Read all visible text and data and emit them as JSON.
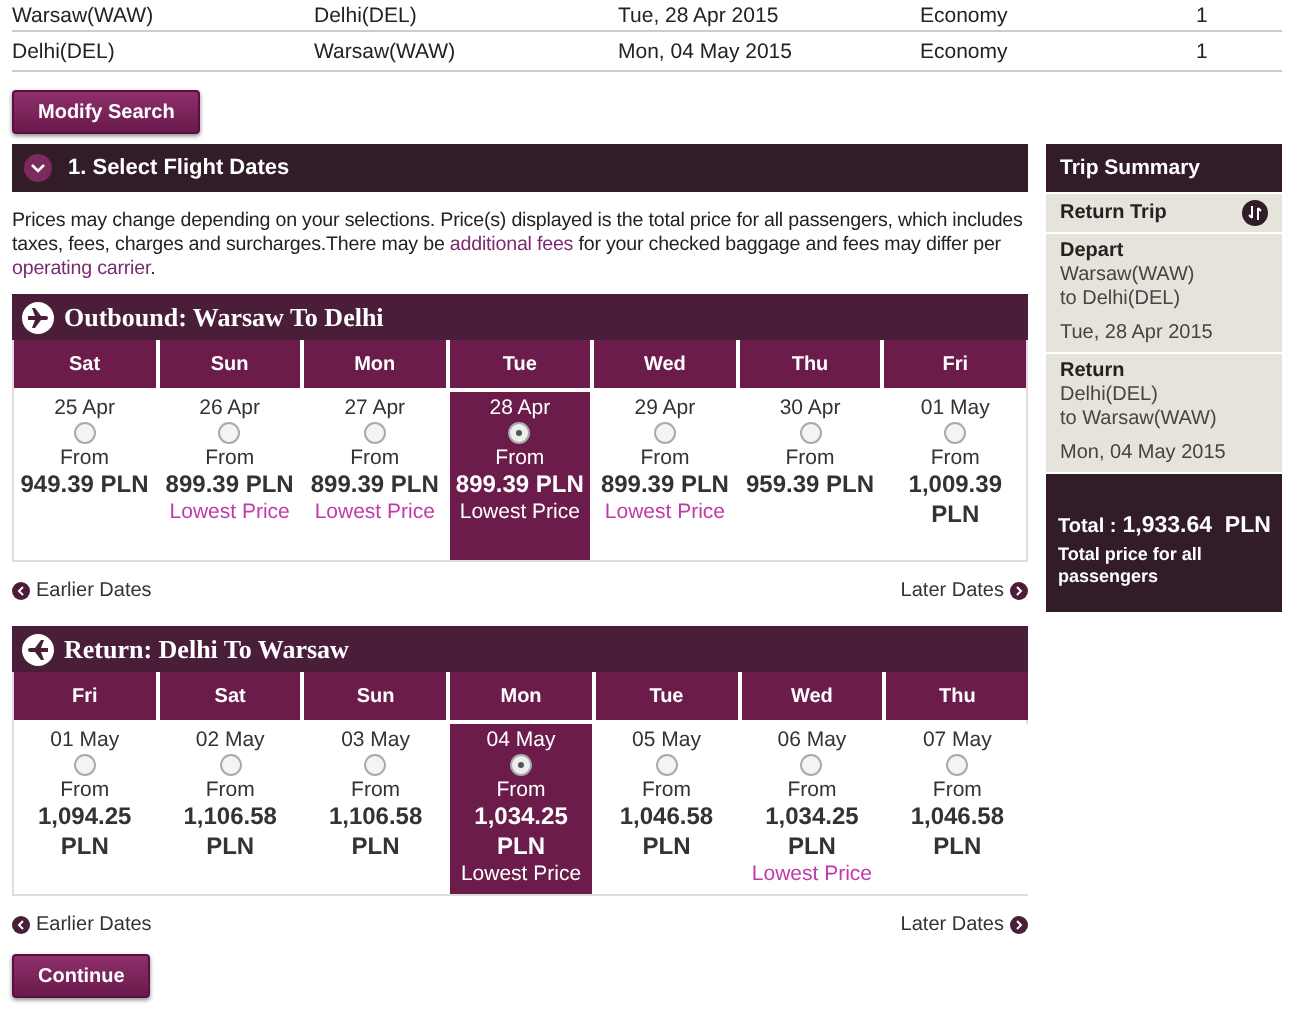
{
  "search_table": {
    "rows": [
      {
        "from": "Warsaw(WAW)",
        "to": "Delhi(DEL)",
        "date": "Tue, 28 Apr 2015",
        "cabin": "Economy",
        "passengers": "1"
      },
      {
        "from": "Delhi(DEL)",
        "to": "Warsaw(WAW)",
        "date": "Mon, 04 May 2015",
        "cabin": "Economy",
        "passengers": "1"
      }
    ]
  },
  "modify_button": "Modify Search",
  "section": {
    "title": "1. Select Flight Dates",
    "expanded": true
  },
  "notice": {
    "text_1": "Prices may change depending on your selections. Price(s) displayed is the total price for all passengers, which includes taxes, fees, charges and surcharges.There may be ",
    "link_1": "additional fees",
    "text_2": " for your checked baggage and fees may differ per ",
    "link_2": "operating carrier",
    "text_3": "."
  },
  "legs": [
    {
      "kind": "outbound",
      "title": "Outbound: Warsaw To Delhi",
      "earlier": "Earlier Dates",
      "later": "Later Dates",
      "days": [
        {
          "weekday": "Sat",
          "date": "25 Apr",
          "from": "From",
          "price": "949.39 PLN",
          "selected": false
        },
        {
          "weekday": "Sun",
          "date": "26 Apr",
          "from": "From",
          "price": "899.39 PLN",
          "note": "Lowest Price",
          "selected": false
        },
        {
          "weekday": "Mon",
          "date": "27 Apr",
          "from": "From",
          "price": "899.39 PLN",
          "note": "Lowest Price",
          "selected": false
        },
        {
          "weekday": "Tue",
          "date": "28 Apr",
          "from": "From",
          "price": "899.39 PLN",
          "note": "Lowest Price",
          "selected": true
        },
        {
          "weekday": "Wed",
          "date": "29 Apr",
          "from": "From",
          "price": "899.39 PLN",
          "note": "Lowest Price",
          "selected": false
        },
        {
          "weekday": "Thu",
          "date": "30 Apr",
          "from": "From",
          "price": "959.39 PLN",
          "selected": false
        },
        {
          "weekday": "Fri",
          "date": "01 May",
          "from": "From",
          "price": "1,009.39 PLN",
          "selected": false
        }
      ]
    },
    {
      "kind": "return",
      "title": "Return: Delhi To Warsaw",
      "earlier": "Earlier Dates",
      "later": "Later Dates",
      "days": [
        {
          "weekday": "Fri",
          "date": "01 May",
          "from": "From",
          "price": "1,094.25 PLN",
          "selected": false
        },
        {
          "weekday": "Sat",
          "date": "02 May",
          "from": "From",
          "price": "1,106.58 PLN",
          "selected": false
        },
        {
          "weekday": "Sun",
          "date": "03 May",
          "from": "From",
          "price": "1,106.58 PLN",
          "selected": false
        },
        {
          "weekday": "Mon",
          "date": "04 May",
          "from": "From",
          "price": "1,034.25 PLN",
          "note": "Lowest Price",
          "selected": true
        },
        {
          "weekday": "Tue",
          "date": "05 May",
          "from": "From",
          "price": "1,046.58 PLN",
          "selected": false
        },
        {
          "weekday": "Wed",
          "date": "06 May",
          "from": "From",
          "price": "1,034.25 PLN",
          "note": "Lowest Price",
          "selected": false
        },
        {
          "weekday": "Thu",
          "date": "07 May",
          "from": "From",
          "price": "1,046.58 PLN",
          "selected": false
        }
      ]
    }
  ],
  "continue_button": "Continue",
  "trip_summary": {
    "title": "Trip Summary",
    "trip_type": "Return Trip",
    "segments": [
      {
        "label": "Depart",
        "from": "Warsaw(WAW)",
        "to": "to Delhi(DEL)",
        "date": "Tue, 28 Apr 2015"
      },
      {
        "label": "Return",
        "from": "Delhi(DEL)",
        "to": "to Warsaw(WAW)",
        "date": "Mon, 04 May 2015"
      }
    ],
    "total_label": "Total :",
    "total": "1,933.64  PLN",
    "total_note": "Total price for all passengers"
  }
}
